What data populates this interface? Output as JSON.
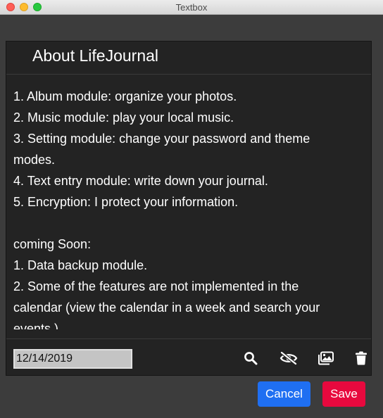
{
  "window": {
    "title": "Textbox"
  },
  "panel": {
    "title": "About LifeJournal",
    "body_lines": [
      "1. Album module: organize your photos.",
      "2. Music module: play your local music.",
      "3. Setting module: change your password and theme",
      "modes.",
      "4. Text entry module: write down your journal.",
      "5. Encryption: I protect your information.",
      "",
      "coming Soon:",
      "1. Data backup module.",
      "2. Some of the features are not implemented in the",
      "calendar (view the calendar in a week and search your",
      "events.)"
    ]
  },
  "footer": {
    "date_value": "12/14/2019",
    "icons": [
      "search-icon",
      "eye-slash-icon",
      "images-icon",
      "trash-icon"
    ]
  },
  "actions": {
    "cancel_label": "Cancel",
    "save_label": "Save"
  },
  "colors": {
    "panel_bg": "#232323",
    "cancel_bg": "#1f6ff2",
    "save_bg": "#e8093e"
  }
}
